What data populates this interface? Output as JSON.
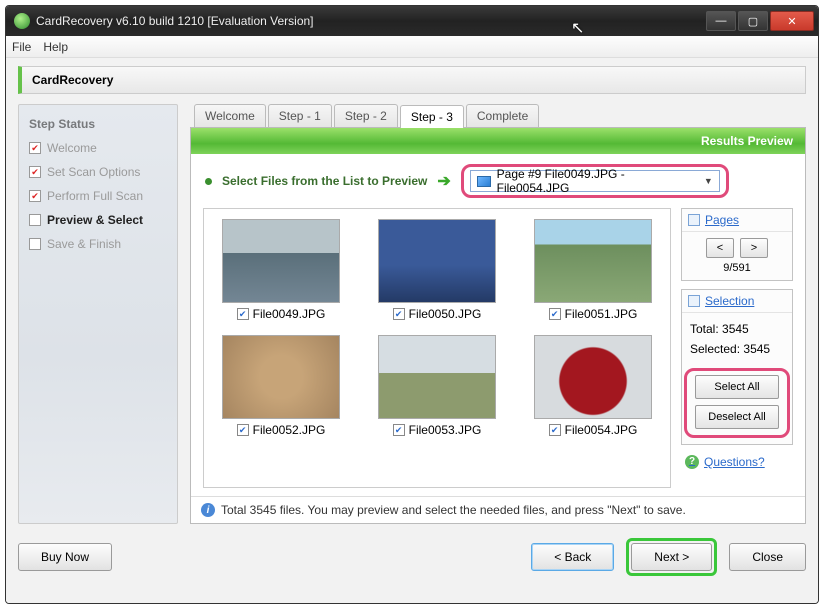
{
  "window": {
    "title": "CardRecovery v6.10 build 1210 [Evaluation Version]"
  },
  "menu": {
    "file": "File",
    "help": "Help"
  },
  "heading": "CardRecovery",
  "sidebar": {
    "title": "Step Status",
    "items": [
      {
        "label": "Welcome",
        "done": true
      },
      {
        "label": "Set Scan Options",
        "done": true
      },
      {
        "label": "Perform Full Scan",
        "done": true
      },
      {
        "label": "Preview & Select",
        "active": true
      },
      {
        "label": "Save & Finish"
      }
    ]
  },
  "tabs": [
    "Welcome",
    "Step - 1",
    "Step - 2",
    "Step - 3",
    "Complete"
  ],
  "active_tab": 3,
  "banner": "Results Preview",
  "select_label": "Select Files from the List to Preview",
  "page_dropdown": "Page #9   File0049.JPG - File0054.JPG",
  "thumbs": [
    {
      "name": "File0049.JPG"
    },
    {
      "name": "File0050.JPG"
    },
    {
      "name": "File0051.JPG"
    },
    {
      "name": "File0052.JPG"
    },
    {
      "name": "File0053.JPG"
    },
    {
      "name": "File0054.JPG"
    }
  ],
  "pages": {
    "title": "Pages",
    "prev": "<",
    "next": ">",
    "indicator": "9/591"
  },
  "selection": {
    "title": "Selection",
    "total_label": "Total:",
    "total_value": "3545",
    "selected_label": "Selected:",
    "selected_value": "3545",
    "select_all": "Select All",
    "deselect_all": "Deselect All"
  },
  "questions": "Questions?",
  "info": "Total 3545 files.  You may preview and select the needed files, and press \"Next\" to save.",
  "footer": {
    "buy": "Buy Now",
    "back": "< Back",
    "next": "Next >",
    "close": "Close"
  }
}
